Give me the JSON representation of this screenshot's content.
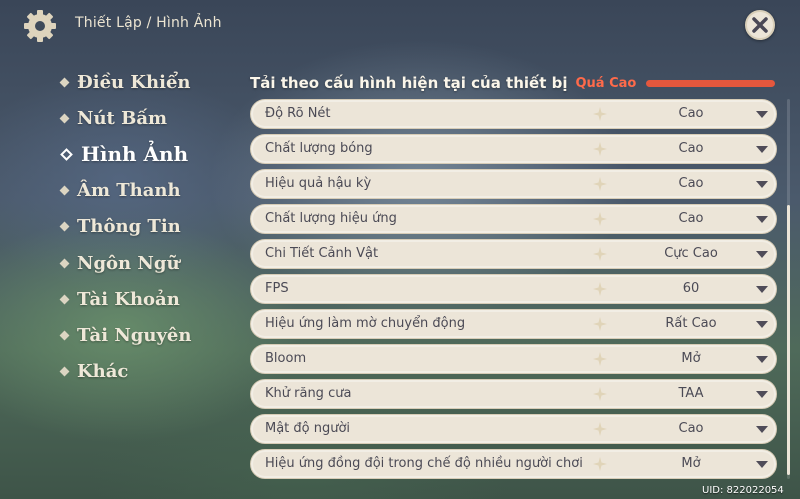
{
  "header": {
    "breadcrumb": "Thiết Lập / Hình Ảnh",
    "close_icon": "close-icon",
    "settings_icon": "gear-icon"
  },
  "sidebar": {
    "items": [
      {
        "label": "Điều Khiển",
        "active": false
      },
      {
        "label": "Nút Bấm",
        "active": false
      },
      {
        "label": "Hình Ảnh",
        "active": true
      },
      {
        "label": "Âm Thanh",
        "active": false
      },
      {
        "label": "Thông Tin",
        "active": false
      },
      {
        "label": "Ngôn Ngữ",
        "active": false
      },
      {
        "label": "Tài Khoản",
        "active": false
      },
      {
        "label": "Tài Nguyên",
        "active": false
      },
      {
        "label": "Khác",
        "active": false
      }
    ]
  },
  "device_load": {
    "label": "Tải theo cấu hình hiện tại của thiết bị",
    "value": "Quá Cao",
    "level": 1.0,
    "color": "#e5573d"
  },
  "settings": [
    {
      "label": "Độ Rõ Nét",
      "value": "Cao"
    },
    {
      "label": "Chất lượng bóng",
      "value": "Cao"
    },
    {
      "label": "Hiệu quả hậu kỳ",
      "value": "Cao"
    },
    {
      "label": "Chất lượng hiệu ứng",
      "value": "Cao"
    },
    {
      "label": "Chi Tiết Cảnh Vật",
      "value": "Cực Cao"
    },
    {
      "label": "FPS",
      "value": "60"
    },
    {
      "label": "Hiệu ứng làm mờ chuyển động",
      "value": "Rất Cao"
    },
    {
      "label": "Bloom",
      "value": "Mở"
    },
    {
      "label": "Khử răng cưa",
      "value": "TAA"
    },
    {
      "label": "Mật độ người",
      "value": "Cao"
    },
    {
      "label": "Hiệu ứng đồng đội trong chế độ nhiều người chơi",
      "value": "Mở"
    }
  ],
  "footer": {
    "uid": "UID: 822022054"
  }
}
